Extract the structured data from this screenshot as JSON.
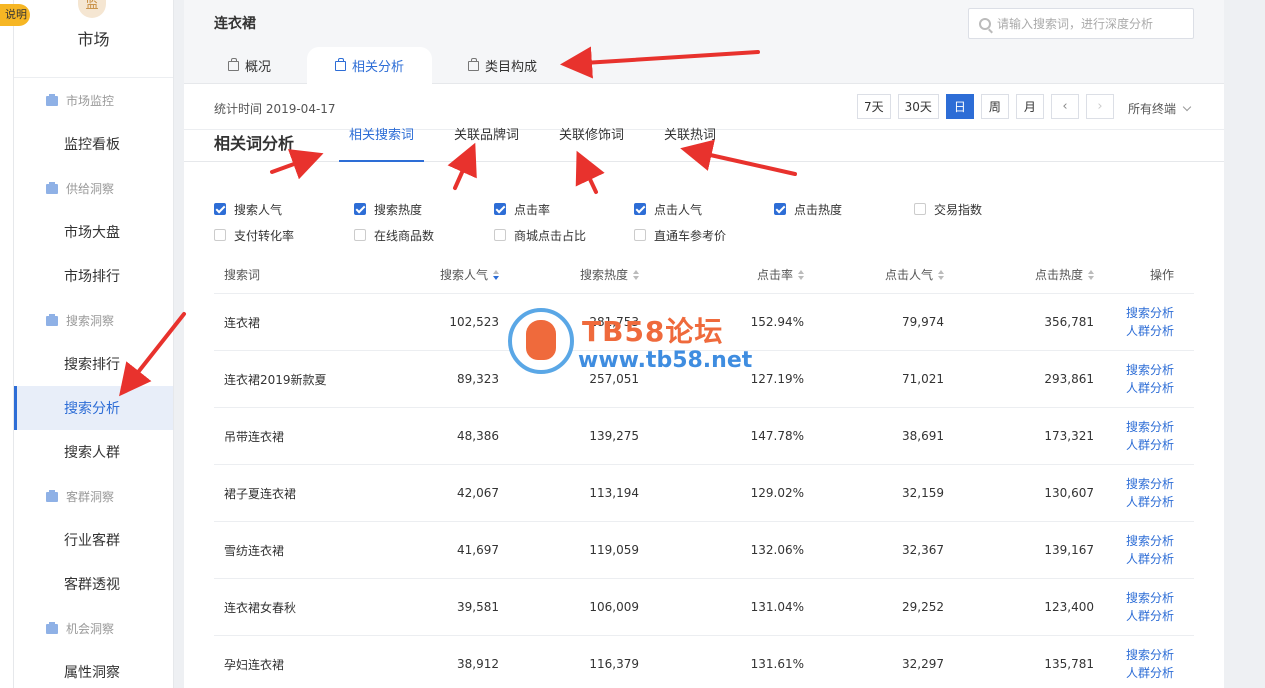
{
  "explain_badge": "说明",
  "sidebar": {
    "market_label": "市场",
    "market_icon_char": "监",
    "groups": [
      {
        "label": "市场监控",
        "items": [
          "监控看板"
        ]
      },
      {
        "label": "供给洞察",
        "items": [
          "市场大盘",
          "市场排行"
        ]
      },
      {
        "label": "搜索洞察",
        "items": [
          "搜索排行",
          "搜索分析",
          "搜索人群"
        ]
      },
      {
        "label": "客群洞察",
        "items": [
          "行业客群",
          "客群透视"
        ]
      },
      {
        "label": "机会洞察",
        "items": [
          "属性洞察"
        ]
      }
    ],
    "active_item": "搜索分析"
  },
  "header": {
    "category": "连衣裙",
    "search_placeholder": "请输入搜索词，进行深度分析",
    "tabs": [
      "概况",
      "相关分析",
      "类目构成"
    ],
    "active_tab": "相关分析"
  },
  "stats": {
    "label": "统计时间 2019-04-17",
    "range_buttons": [
      "7天",
      "30天",
      "日",
      "周",
      "月"
    ],
    "active_range": "日",
    "prev": "‹",
    "next": "›",
    "terminal": "所有终端"
  },
  "analysis": {
    "title": "相关词分析",
    "subtabs": [
      "相关搜索词",
      "关联品牌词",
      "关联修饰词",
      "关联热词"
    ],
    "active_subtab": "相关搜索词"
  },
  "metrics": [
    [
      {
        "label": "搜索人气",
        "checked": true
      },
      {
        "label": "搜索热度",
        "checked": true
      },
      {
        "label": "点击率",
        "checked": true
      },
      {
        "label": "点击人气",
        "checked": true
      },
      {
        "label": "点击热度",
        "checked": true
      },
      {
        "label": "交易指数",
        "checked": false
      }
    ],
    [
      {
        "label": "支付转化率",
        "checked": false
      },
      {
        "label": "在线商品数",
        "checked": false
      },
      {
        "label": "商城点击占比",
        "checked": false
      },
      {
        "label": "直通车参考价",
        "checked": false
      }
    ]
  ],
  "table": {
    "headers": [
      "搜索词",
      "搜索人气",
      "搜索热度",
      "点击率",
      "点击人气",
      "点击热度",
      "操作"
    ],
    "rows": [
      [
        "连衣裙",
        "102,523",
        "281,753",
        "152.94%",
        "79,974",
        "356,781"
      ],
      [
        "连衣裙2019新款夏",
        "89,323",
        "257,051",
        "127.19%",
        "71,021",
        "293,861"
      ],
      [
        "吊带连衣裙",
        "48,386",
        "139,275",
        "147.78%",
        "38,691",
        "173,321"
      ],
      [
        "裙子夏连衣裙",
        "42,067",
        "113,194",
        "129.02%",
        "32,159",
        "130,607"
      ],
      [
        "雪纺连衣裙",
        "41,697",
        "119,059",
        "132.06%",
        "32,367",
        "139,167"
      ],
      [
        "连衣裙女春秋",
        "39,581",
        "106,009",
        "131.04%",
        "29,252",
        "123,400"
      ],
      [
        "孕妇连衣裙",
        "38,912",
        "116,379",
        "131.61%",
        "32,297",
        "135,781"
      ]
    ],
    "op_search": "搜索分析",
    "op_crowd": "人群分析"
  },
  "watermark": {
    "title": "TB58论坛",
    "url": "www.tb58.net"
  },
  "colors": {
    "accent": "#2d6dd6",
    "arrow": "#e8322d",
    "watermark_orange": "#ef6a3c",
    "watermark_blue": "#3f8de0"
  }
}
